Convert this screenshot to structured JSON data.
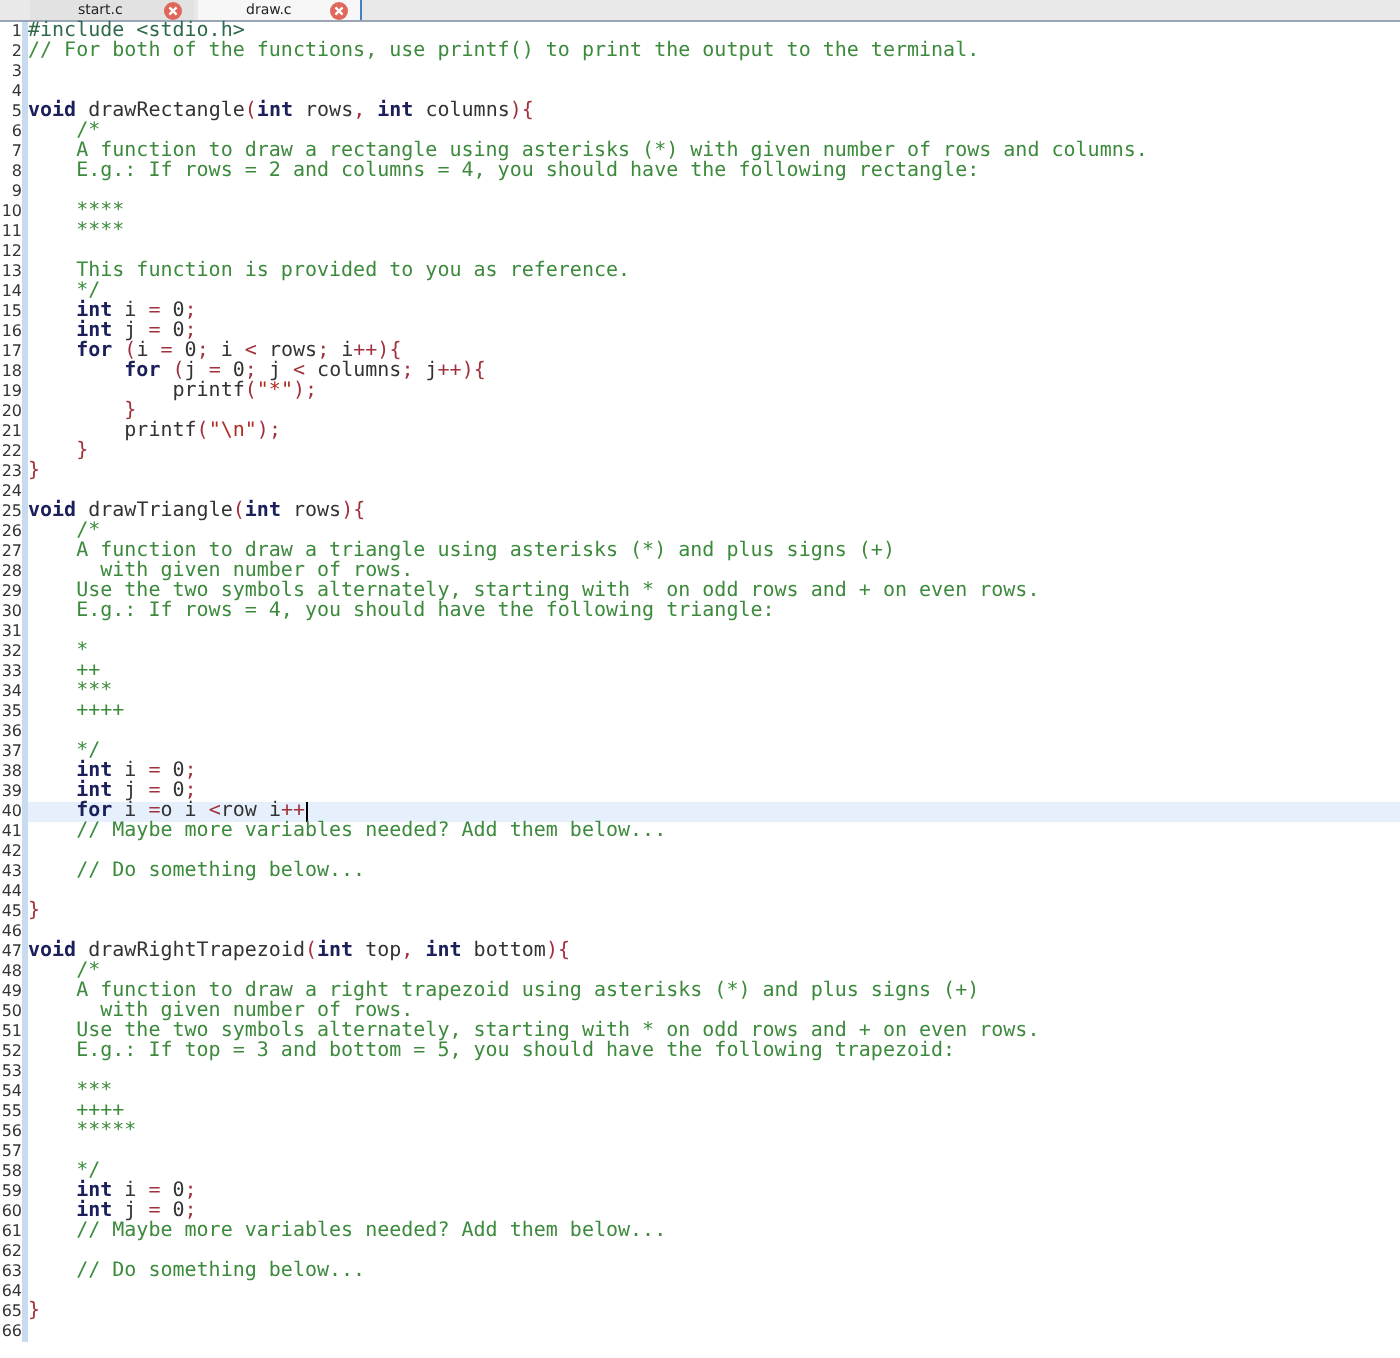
{
  "tabs": [
    {
      "label": "start.c",
      "selected": false
    },
    {
      "label": "draw.c",
      "selected": true
    }
  ],
  "editor": {
    "lines": [
      {
        "number": "1",
        "current": false,
        "tokens": [
          {
            "kind": "pre",
            "text": "#include <stdio.h>"
          }
        ]
      },
      {
        "number": "2",
        "current": false,
        "tokens": [
          {
            "kind": "comment",
            "text": "// For both of the functions, use printf() to print the output to the terminal."
          }
        ]
      },
      {
        "number": "3",
        "current": false
      },
      {
        "number": "4",
        "current": false
      },
      {
        "number": "5",
        "current": false,
        "tokens": [
          {
            "kind": "keyword",
            "text": "void"
          },
          {
            "kind": "plain",
            "text": " drawRectangle"
          },
          {
            "kind": "op",
            "text": "("
          },
          {
            "kind": "keyword",
            "text": "int"
          },
          {
            "kind": "plain",
            "text": " rows"
          },
          {
            "kind": "op",
            "text": ", "
          },
          {
            "kind": "keyword",
            "text": "int"
          },
          {
            "kind": "plain",
            "text": " columns"
          },
          {
            "kind": "op",
            "text": "){"
          }
        ]
      },
      {
        "number": "6",
        "current": false,
        "tokens": [
          {
            "kind": "comment",
            "text": "    /*"
          }
        ]
      },
      {
        "number": "7",
        "current": false,
        "tokens": [
          {
            "kind": "comment",
            "text": "    A function to draw a rectangle using asterisks (*) with given number of rows and columns."
          }
        ]
      },
      {
        "number": "8",
        "current": false,
        "tokens": [
          {
            "kind": "comment",
            "text": "    E.g.: If rows = 2 and columns = 4, you should have the following rectangle:"
          }
        ]
      },
      {
        "number": "9",
        "current": false
      },
      {
        "number": "10",
        "current": false,
        "tokens": [
          {
            "kind": "comment",
            "text": "    ****"
          }
        ]
      },
      {
        "number": "11",
        "current": false,
        "tokens": [
          {
            "kind": "comment",
            "text": "    ****"
          }
        ]
      },
      {
        "number": "12",
        "current": false
      },
      {
        "number": "13",
        "current": false,
        "tokens": [
          {
            "kind": "comment",
            "text": "    This function is provided to you as reference."
          }
        ]
      },
      {
        "number": "14",
        "current": false,
        "tokens": [
          {
            "kind": "comment",
            "text": "    */"
          }
        ]
      },
      {
        "number": "15",
        "current": false,
        "tokens": [
          {
            "kind": "keyword",
            "text": "    int"
          },
          {
            "kind": "plain",
            "text": " i "
          },
          {
            "kind": "op",
            "text": "="
          },
          {
            "kind": "plain",
            "text": " 0"
          },
          {
            "kind": "op",
            "text": ";"
          }
        ]
      },
      {
        "number": "16",
        "current": false,
        "tokens": [
          {
            "kind": "keyword",
            "text": "    int"
          },
          {
            "kind": "plain",
            "text": " j "
          },
          {
            "kind": "op",
            "text": "="
          },
          {
            "kind": "plain",
            "text": " 0"
          },
          {
            "kind": "op",
            "text": ";"
          }
        ]
      },
      {
        "number": "17",
        "current": false,
        "tokens": [
          {
            "kind": "keyword",
            "text": "    for"
          },
          {
            "kind": "op",
            "text": " ("
          },
          {
            "kind": "plain",
            "text": "i "
          },
          {
            "kind": "op",
            "text": "="
          },
          {
            "kind": "plain",
            "text": " 0"
          },
          {
            "kind": "op",
            "text": ";"
          },
          {
            "kind": "plain",
            "text": " i "
          },
          {
            "kind": "op",
            "text": "<"
          },
          {
            "kind": "plain",
            "text": " rows"
          },
          {
            "kind": "op",
            "text": ";"
          },
          {
            "kind": "plain",
            "text": " i"
          },
          {
            "kind": "op",
            "text": "++){"
          }
        ]
      },
      {
        "number": "18",
        "current": false,
        "tokens": [
          {
            "kind": "keyword",
            "text": "        for"
          },
          {
            "kind": "op",
            "text": " ("
          },
          {
            "kind": "plain",
            "text": "j "
          },
          {
            "kind": "op",
            "text": "="
          },
          {
            "kind": "plain",
            "text": " 0"
          },
          {
            "kind": "op",
            "text": ";"
          },
          {
            "kind": "plain",
            "text": " j "
          },
          {
            "kind": "op",
            "text": "<"
          },
          {
            "kind": "plain",
            "text": " columns"
          },
          {
            "kind": "op",
            "text": ";"
          },
          {
            "kind": "plain",
            "text": " j"
          },
          {
            "kind": "op",
            "text": "++){"
          }
        ]
      },
      {
        "number": "19",
        "current": false,
        "tokens": [
          {
            "kind": "plain",
            "text": "            printf"
          },
          {
            "kind": "op",
            "text": "("
          },
          {
            "kind": "string",
            "text": "\"*\""
          },
          {
            "kind": "op",
            "text": ");"
          }
        ]
      },
      {
        "number": "20",
        "current": false,
        "tokens": [
          {
            "kind": "op",
            "text": "        }"
          }
        ]
      },
      {
        "number": "21",
        "current": false,
        "tokens": [
          {
            "kind": "plain",
            "text": "        printf"
          },
          {
            "kind": "op",
            "text": "("
          },
          {
            "kind": "string",
            "text": "\"\\n\""
          },
          {
            "kind": "op",
            "text": ");"
          }
        ]
      },
      {
        "number": "22",
        "current": false,
        "tokens": [
          {
            "kind": "op",
            "text": "    }"
          }
        ]
      },
      {
        "number": "23",
        "current": false,
        "tokens": [
          {
            "kind": "op",
            "text": "}"
          }
        ]
      },
      {
        "number": "24",
        "current": false
      },
      {
        "number": "25",
        "current": false,
        "tokens": [
          {
            "kind": "keyword",
            "text": "void"
          },
          {
            "kind": "plain",
            "text": " drawTriangle"
          },
          {
            "kind": "op",
            "text": "("
          },
          {
            "kind": "keyword",
            "text": "int"
          },
          {
            "kind": "plain",
            "text": " rows"
          },
          {
            "kind": "op",
            "text": "){"
          }
        ]
      },
      {
        "number": "26",
        "current": false,
        "tokens": [
          {
            "kind": "comment",
            "text": "    /*"
          }
        ]
      },
      {
        "number": "27",
        "current": false,
        "tokens": [
          {
            "kind": "comment",
            "text": "    A function to draw a triangle using asterisks (*) and plus signs (+)"
          }
        ]
      },
      {
        "number": "28",
        "current": false,
        "tokens": [
          {
            "kind": "comment",
            "text": "      with given number of rows."
          }
        ]
      },
      {
        "number": "29",
        "current": false,
        "tokens": [
          {
            "kind": "comment",
            "text": "    Use the two symbols alternately, starting with * on odd rows and + on even rows."
          }
        ]
      },
      {
        "number": "30",
        "current": false,
        "tokens": [
          {
            "kind": "comment",
            "text": "    E.g.: If rows = 4, you should have the following triangle:"
          }
        ]
      },
      {
        "number": "31",
        "current": false
      },
      {
        "number": "32",
        "current": false,
        "tokens": [
          {
            "kind": "comment",
            "text": "    *"
          }
        ]
      },
      {
        "number": "33",
        "current": false,
        "tokens": [
          {
            "kind": "comment",
            "text": "    ++"
          }
        ]
      },
      {
        "number": "34",
        "current": false,
        "tokens": [
          {
            "kind": "comment",
            "text": "    ***"
          }
        ]
      },
      {
        "number": "35",
        "current": false,
        "tokens": [
          {
            "kind": "comment",
            "text": "    ++++"
          }
        ]
      },
      {
        "number": "36",
        "current": false
      },
      {
        "number": "37",
        "current": false,
        "tokens": [
          {
            "kind": "comment",
            "text": "    */"
          }
        ]
      },
      {
        "number": "38",
        "current": false,
        "tokens": [
          {
            "kind": "keyword",
            "text": "    int"
          },
          {
            "kind": "plain",
            "text": " i "
          },
          {
            "kind": "op",
            "text": "="
          },
          {
            "kind": "plain",
            "text": " 0"
          },
          {
            "kind": "op",
            "text": ";"
          }
        ]
      },
      {
        "number": "39",
        "current": false,
        "tokens": [
          {
            "kind": "keyword",
            "text": "    int"
          },
          {
            "kind": "plain",
            "text": " j "
          },
          {
            "kind": "op",
            "text": "="
          },
          {
            "kind": "plain",
            "text": " 0"
          },
          {
            "kind": "op",
            "text": ";"
          }
        ]
      },
      {
        "number": "40",
        "current": true,
        "tokens": [
          {
            "kind": "keyword",
            "text": "    for"
          },
          {
            "kind": "plain",
            "text": " i "
          },
          {
            "kind": "op",
            "text": "="
          },
          {
            "kind": "plain",
            "text": "o i "
          },
          {
            "kind": "op",
            "text": "<"
          },
          {
            "kind": "plain",
            "text": "row i"
          },
          {
            "kind": "op",
            "text": "++"
          }
        ]
      },
      {
        "number": "41",
        "current": false,
        "tokens": [
          {
            "kind": "comment",
            "text": "    // Maybe more variables needed? Add them below..."
          }
        ]
      },
      {
        "number": "42",
        "current": false
      },
      {
        "number": "43",
        "current": false,
        "tokens": [
          {
            "kind": "comment",
            "text": "    // Do something below..."
          }
        ]
      },
      {
        "number": "44",
        "current": false
      },
      {
        "number": "45",
        "current": false,
        "tokens": [
          {
            "kind": "op",
            "text": "}"
          }
        ]
      },
      {
        "number": "46",
        "current": false
      },
      {
        "number": "47",
        "current": false,
        "tokens": [
          {
            "kind": "keyword",
            "text": "void"
          },
          {
            "kind": "plain",
            "text": " drawRightTrapezoid"
          },
          {
            "kind": "op",
            "text": "("
          },
          {
            "kind": "keyword",
            "text": "int"
          },
          {
            "kind": "plain",
            "text": " top"
          },
          {
            "kind": "op",
            "text": ", "
          },
          {
            "kind": "keyword",
            "text": "int"
          },
          {
            "kind": "plain",
            "text": " bottom"
          },
          {
            "kind": "op",
            "text": "){"
          }
        ]
      },
      {
        "number": "48",
        "current": false,
        "tokens": [
          {
            "kind": "comment",
            "text": "    /*"
          }
        ]
      },
      {
        "number": "49",
        "current": false,
        "tokens": [
          {
            "kind": "comment",
            "text": "    A function to draw a right trapezoid using asterisks (*) and plus signs (+)"
          }
        ]
      },
      {
        "number": "50",
        "current": false,
        "tokens": [
          {
            "kind": "comment",
            "text": "      with given number of rows."
          }
        ]
      },
      {
        "number": "51",
        "current": false,
        "tokens": [
          {
            "kind": "comment",
            "text": "    Use the two symbols alternately, starting with * on odd rows and + on even rows."
          }
        ]
      },
      {
        "number": "52",
        "current": false,
        "tokens": [
          {
            "kind": "comment",
            "text": "    E.g.: If top = 3 and bottom = 5, you should have the following trapezoid:"
          }
        ]
      },
      {
        "number": "53",
        "current": false
      },
      {
        "number": "54",
        "current": false,
        "tokens": [
          {
            "kind": "comment",
            "text": "    ***"
          }
        ]
      },
      {
        "number": "55",
        "current": false,
        "tokens": [
          {
            "kind": "comment",
            "text": "    ++++"
          }
        ]
      },
      {
        "number": "56",
        "current": false,
        "tokens": [
          {
            "kind": "comment",
            "text": "    *****"
          }
        ]
      },
      {
        "number": "57",
        "current": false
      },
      {
        "number": "58",
        "current": false,
        "tokens": [
          {
            "kind": "comment",
            "text": "    */"
          }
        ]
      },
      {
        "number": "59",
        "current": false,
        "tokens": [
          {
            "kind": "keyword",
            "text": "    int"
          },
          {
            "kind": "plain",
            "text": " i "
          },
          {
            "kind": "op",
            "text": "="
          },
          {
            "kind": "plain",
            "text": " 0"
          },
          {
            "kind": "op",
            "text": ";"
          }
        ]
      },
      {
        "number": "60",
        "current": false,
        "tokens": [
          {
            "kind": "keyword",
            "text": "    int"
          },
          {
            "kind": "plain",
            "text": " j "
          },
          {
            "kind": "op",
            "text": "="
          },
          {
            "kind": "plain",
            "text": " 0"
          },
          {
            "kind": "op",
            "text": ";"
          }
        ]
      },
      {
        "number": "61",
        "current": false,
        "tokens": [
          {
            "kind": "comment",
            "text": "    // Maybe more variables needed? Add them below..."
          }
        ]
      },
      {
        "number": "62",
        "current": false
      },
      {
        "number": "63",
        "current": false,
        "tokens": [
          {
            "kind": "comment",
            "text": "    // Do something below..."
          }
        ]
      },
      {
        "number": "64",
        "current": false
      },
      {
        "number": "65",
        "current": false,
        "tokens": [
          {
            "kind": "op",
            "text": "}"
          }
        ]
      },
      {
        "number": "66",
        "current": false
      }
    ]
  }
}
